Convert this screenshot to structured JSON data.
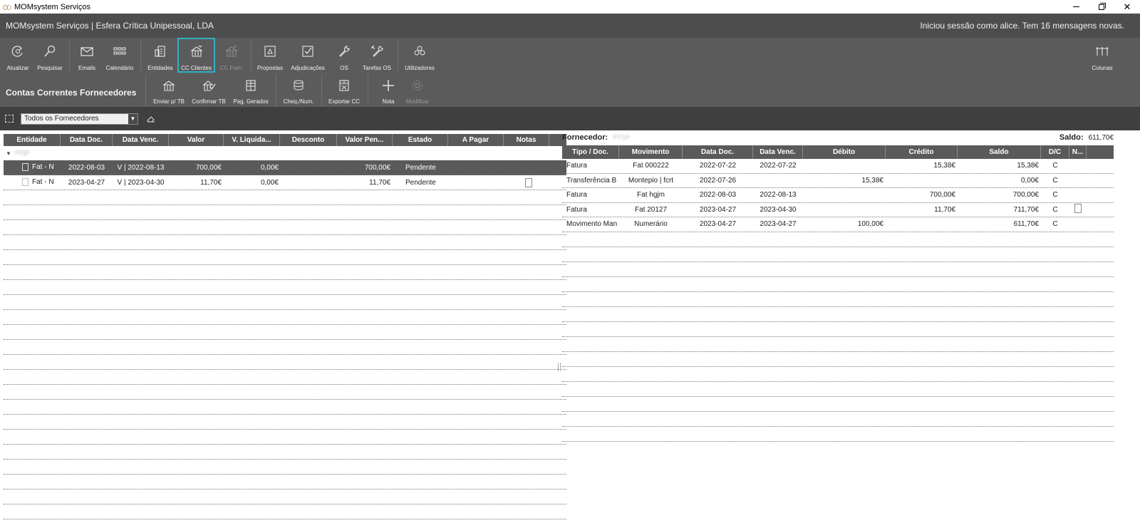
{
  "window": {
    "title": "MOMsystem Serviços",
    "controls": {
      "minimize": "minimize-icon",
      "restore": "restore-icon",
      "close": "✕"
    }
  },
  "header": {
    "company": "MOMsystem Serviços | Esfera Crítica Unipessoal, LDA",
    "session": "Iniciou sessão como alice.  Tem 16 mensagens novas."
  },
  "ribbon": {
    "atualizar": "Atualizar",
    "pesquisar": "Pesquisar",
    "emails": "Emails",
    "calendario": "Calendário",
    "entidades": "Entidades",
    "cc_clientes": "CC Clientes",
    "cc_forn": "CC Forn.",
    "propostas": "Propostas",
    "adjudicacoes": "Adjudicações",
    "os": "OS",
    "tarefas_os": "Tarefas OS",
    "utilizadores": "Utilizadores",
    "colunas": "Colunas"
  },
  "section": {
    "title": "Contas Correntes Fornecedores",
    "enviar_tb": "Enviar p/ TB",
    "confirmar_tb": "Confirmar TB",
    "pag_gerados": "Pag. Gerados",
    "cheq_num": "Cheq./Num.",
    "exportar_cc": "Exportar CC",
    "nota": "Nota",
    "modificar": "Modificar"
  },
  "filter": {
    "selected": "Todos os Fornecedores"
  },
  "left_table": {
    "columns": [
      "Entidade",
      "Data Doc.",
      "Data Venc.",
      "Valor",
      "V. Liquida...",
      "Desconto",
      "Valor Pen...",
      "Estado",
      "A Pagar",
      "Notas"
    ],
    "group_label": "PTSP",
    "rows": [
      {
        "entidade": "Fat - N",
        "data_doc": "2022-08-03",
        "data_venc": "V | 2022-08-13",
        "valor": "700,00€",
        "v_liquidado": "0,00€",
        "desconto": "",
        "valor_pendente": "700,00€",
        "estado": "Pendente",
        "a_pagar": "",
        "notas": ""
      },
      {
        "entidade": "Fat - N",
        "data_doc": "2023-04-27",
        "data_venc": "V | 2023-04-30",
        "valor": "11,70€",
        "v_liquidado": "0,00€",
        "desconto": "",
        "valor_pendente": "11,70€",
        "estado": "Pendente",
        "a_pagar": "",
        "notas": "note"
      }
    ]
  },
  "right_panel": {
    "fornecedor_label": "Fornecedor:",
    "fornecedor_value": "PTSP",
    "saldo_label": "Saldo:",
    "saldo_value": "611,70€",
    "columns": [
      "Tipo / Doc.",
      "Movimento",
      "Data Doc.",
      "Data Venc.",
      "Débito",
      "Crédito",
      "Saldo",
      "D/C",
      "N..."
    ],
    "rows": [
      {
        "tipo": "Fatura",
        "movimento": "Fat 000222",
        "data_doc": "2022-07-22",
        "data_venc": "2022-07-22",
        "debito": "",
        "credito": "15,38€",
        "saldo": "15,38€",
        "dc": "C",
        "nota": ""
      },
      {
        "tipo": "Transferência B",
        "movimento": "Montepio | fcrt",
        "data_doc": "2022-07-26",
        "data_venc": "",
        "debito": "15,38€",
        "credito": "",
        "saldo": "0,00€",
        "dc": "C",
        "nota": ""
      },
      {
        "tipo": "Fatura",
        "movimento": "Fat hgjm",
        "data_doc": "2022-08-03",
        "data_venc": "2022-08-13",
        "debito": "",
        "credito": "700,00€",
        "saldo": "700,00€",
        "dc": "C",
        "nota": ""
      },
      {
        "tipo": "Fatura",
        "movimento": "Fat 20127",
        "data_doc": "2023-04-27",
        "data_venc": "2023-04-30",
        "debito": "",
        "credito": "11,70€",
        "saldo": "711,70€",
        "dc": "C",
        "nota": "note"
      },
      {
        "tipo": "Movimento Man",
        "movimento": "Numerário",
        "data_doc": "2023-04-27",
        "data_venc": "2023-04-27",
        "debito": "100,00€",
        "credito": "",
        "saldo": "611,70€",
        "dc": "C",
        "nota": ""
      }
    ]
  }
}
